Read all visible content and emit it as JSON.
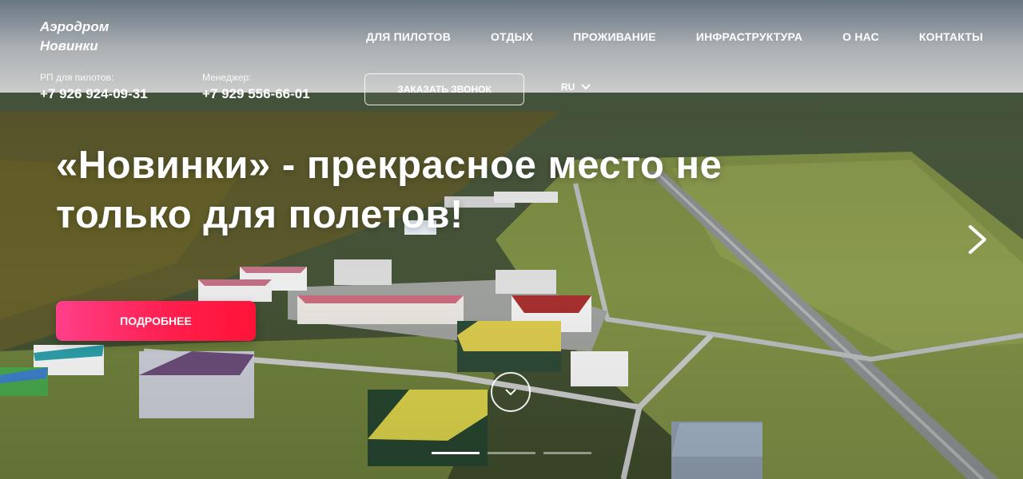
{
  "logo": {
    "line1": "Аэродром",
    "line2": "Новинки"
  },
  "nav": [
    {
      "label": "ДЛЯ ПИЛОТОВ"
    },
    {
      "label": "ОТДЫХ"
    },
    {
      "label": "ПРОЖИВАНИЕ"
    },
    {
      "label": "ИНФРАСТРУКТУРА"
    },
    {
      "label": "О НАС"
    },
    {
      "label": "КОНТАКТЫ"
    }
  ],
  "contacts": {
    "pilots_label": "РП для пилотов:",
    "pilots_phone": "+7 926 924-09-31",
    "manager_label": "Менеджер:",
    "manager_phone": "+7 929 556-66-01"
  },
  "callback_button": "ЗАКАЗАТЬ ЗВОНОК",
  "language": "RU",
  "hero": {
    "headline_line1": "«Новинки» - прекрасное место не",
    "headline_line2": "только для полетов!",
    "more_button": "ПОДРОБНЕЕ"
  },
  "slider": {
    "total_slides": 3,
    "active_index": 0
  },
  "colors": {
    "cta_start": "#ff3f8a",
    "cta_end": "#ff1338",
    "text": "#ffffff"
  },
  "icons": {
    "next": "chevron-right-icon",
    "scroll": "chevron-down-icon",
    "lang": "chevron-down-icon"
  }
}
